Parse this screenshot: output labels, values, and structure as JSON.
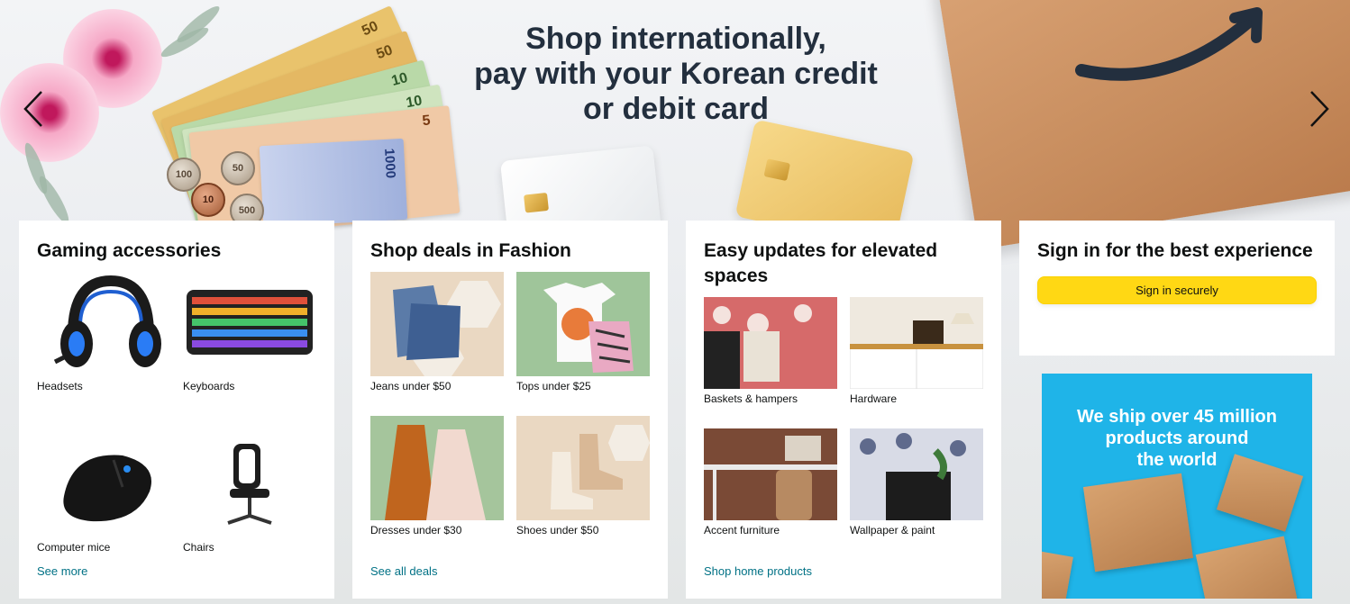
{
  "hero": {
    "headline_lines": [
      "Shop internationally,",
      "pay with your Korean credit",
      "or debit card"
    ],
    "prev_arrow": "chevron-left-icon",
    "next_arrow": "chevron-right-icon"
  },
  "cards": [
    {
      "title": "Gaming accessories",
      "items": [
        {
          "label": "Headsets",
          "icon": "headset-image"
        },
        {
          "label": "Keyboards",
          "icon": "keyboard-image"
        },
        {
          "label": "Computer mice",
          "icon": "mouse-image"
        },
        {
          "label": "Chairs",
          "icon": "chair-image"
        }
      ],
      "link": "See more"
    },
    {
      "title": "Shop deals in Fashion",
      "items": [
        {
          "label": "Jeans under $50",
          "icon": "jeans-image"
        },
        {
          "label": "Tops under $25",
          "icon": "tops-image"
        },
        {
          "label": "Dresses under $30",
          "icon": "dresses-image"
        },
        {
          "label": "Shoes under $50",
          "icon": "shoes-image"
        }
      ],
      "link": "See all deals"
    },
    {
      "title": "Easy updates for elevated spaces",
      "items": [
        {
          "label": "Baskets & hampers",
          "icon": "basket-image"
        },
        {
          "label": "Hardware",
          "icon": "hardware-image"
        },
        {
          "label": "Accent furniture",
          "icon": "furniture-image"
        },
        {
          "label": "Wallpaper & paint",
          "icon": "wallpaper-image"
        }
      ],
      "link": "Shop home products"
    }
  ],
  "signin": {
    "title": "Sign in for the best experience",
    "button": "Sign in securely"
  },
  "ad": {
    "lines": [
      "We ship over 45 million",
      "products around",
      "the world"
    ]
  },
  "colors": {
    "link": "#007185",
    "signin_button": "#ffd814",
    "ad_background": "#1fb4e8",
    "headline": "#232f3e"
  },
  "hero_decor": {
    "bill_labels": [
      "50",
      "50",
      "10",
      "10",
      "5",
      "1000"
    ],
    "coin_labels": [
      "100",
      "50",
      "500",
      "10"
    ]
  }
}
